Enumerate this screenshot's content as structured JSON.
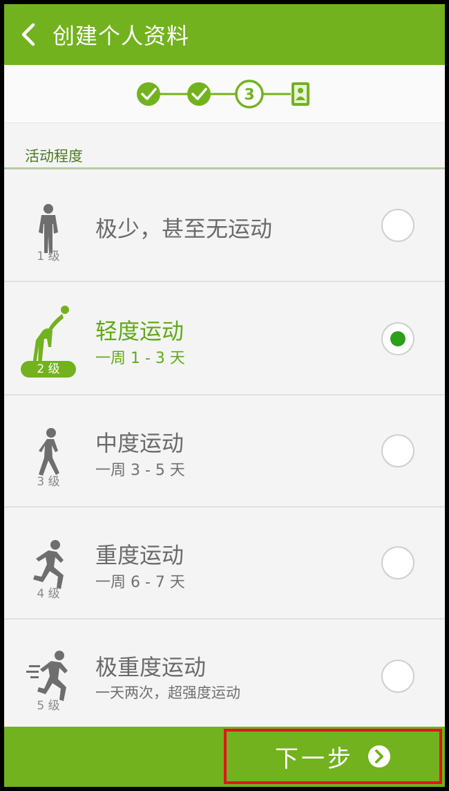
{
  "header": {
    "title": "创建个人资料"
  },
  "stepper": {
    "current_step_label": "3"
  },
  "section": {
    "label": "活动程度"
  },
  "activity_levels": [
    {
      "level": "1 级",
      "title": "极少，甚至无运动",
      "subtitle": "",
      "selected": false
    },
    {
      "level": "2 级",
      "title": "轻度运动",
      "subtitle": "一周 1 - 3 天",
      "selected": true
    },
    {
      "level": "3 级",
      "title": "中度运动",
      "subtitle": "一周 3 - 5 天",
      "selected": false
    },
    {
      "level": "4 级",
      "title": "重度运动",
      "subtitle": "一周 6 - 7 天",
      "selected": false
    },
    {
      "level": "5 级",
      "title": "极重度运动",
      "subtitle": "一天两次，超强度运动",
      "selected": false
    }
  ],
  "footer": {
    "next_label": "下一步"
  },
  "colors": {
    "brand_green": "#72b21e",
    "selected_green": "#2f9e1b",
    "highlight_red": "#e0161b"
  }
}
